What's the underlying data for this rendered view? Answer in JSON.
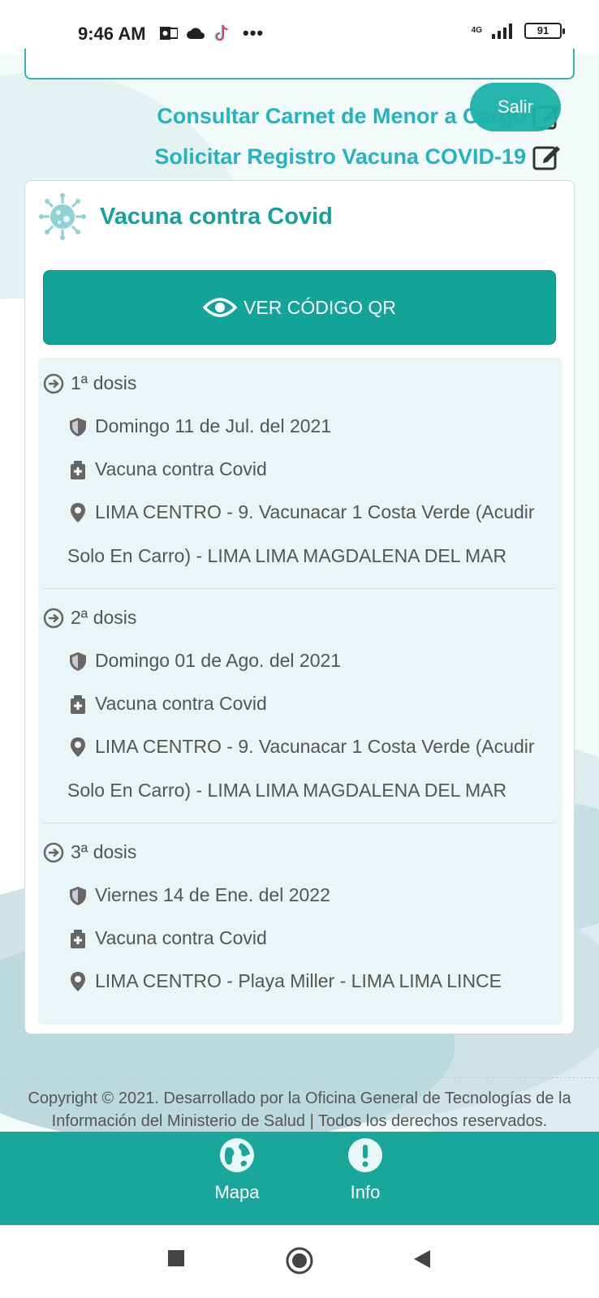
{
  "status_bar": {
    "time": "9:46 AM",
    "network": "4G",
    "battery": "91"
  },
  "header": {
    "logout_label": "Salir",
    "links": [
      {
        "label": "Consultar Carnet de Menor a Cargo"
      },
      {
        "label": "Solicitar Registro Vacuna COVID-19"
      }
    ]
  },
  "card": {
    "title": "Vacuna contra Covid",
    "qr_button_label": "VER CÓDIGO QR",
    "doses": [
      {
        "title": "1ª dosis",
        "date": "Domingo 11 de Jul. del 2021",
        "vaccine": "Vacuna contra Covid",
        "location": "LIMA CENTRO - 9. Vacunacar 1 Costa Verde (Acudir Solo En Carro) - LIMA LIMA MAGDALENA DEL MAR"
      },
      {
        "title": "2ª dosis",
        "date": "Domingo 01 de Ago. del 2021",
        "vaccine": "Vacuna contra Covid",
        "location": "LIMA CENTRO - 9. Vacunacar 1 Costa Verde (Acudir Solo En Carro) - LIMA LIMA MAGDALENA DEL MAR"
      },
      {
        "title": "3ª dosis",
        "date": "Viernes 14 de Ene. del 2022",
        "vaccine": "Vacuna contra Covid",
        "location": "LIMA CENTRO - Playa Miller - LIMA LIMA LINCE"
      }
    ]
  },
  "footer": {
    "copyright": "Copyright © 2021. Desarrollado por la Oficina General de Tecnologías de la Información del Ministerio de Salud | Todos los derechos reservados."
  },
  "bottom_nav": {
    "items": [
      {
        "label": "Mapa",
        "icon": "globe-icon"
      },
      {
        "label": "Info",
        "icon": "exclamation-icon"
      }
    ]
  },
  "colors": {
    "accent": "#14a29b",
    "link": "#26b3c0",
    "navbar": "#19a79b"
  }
}
